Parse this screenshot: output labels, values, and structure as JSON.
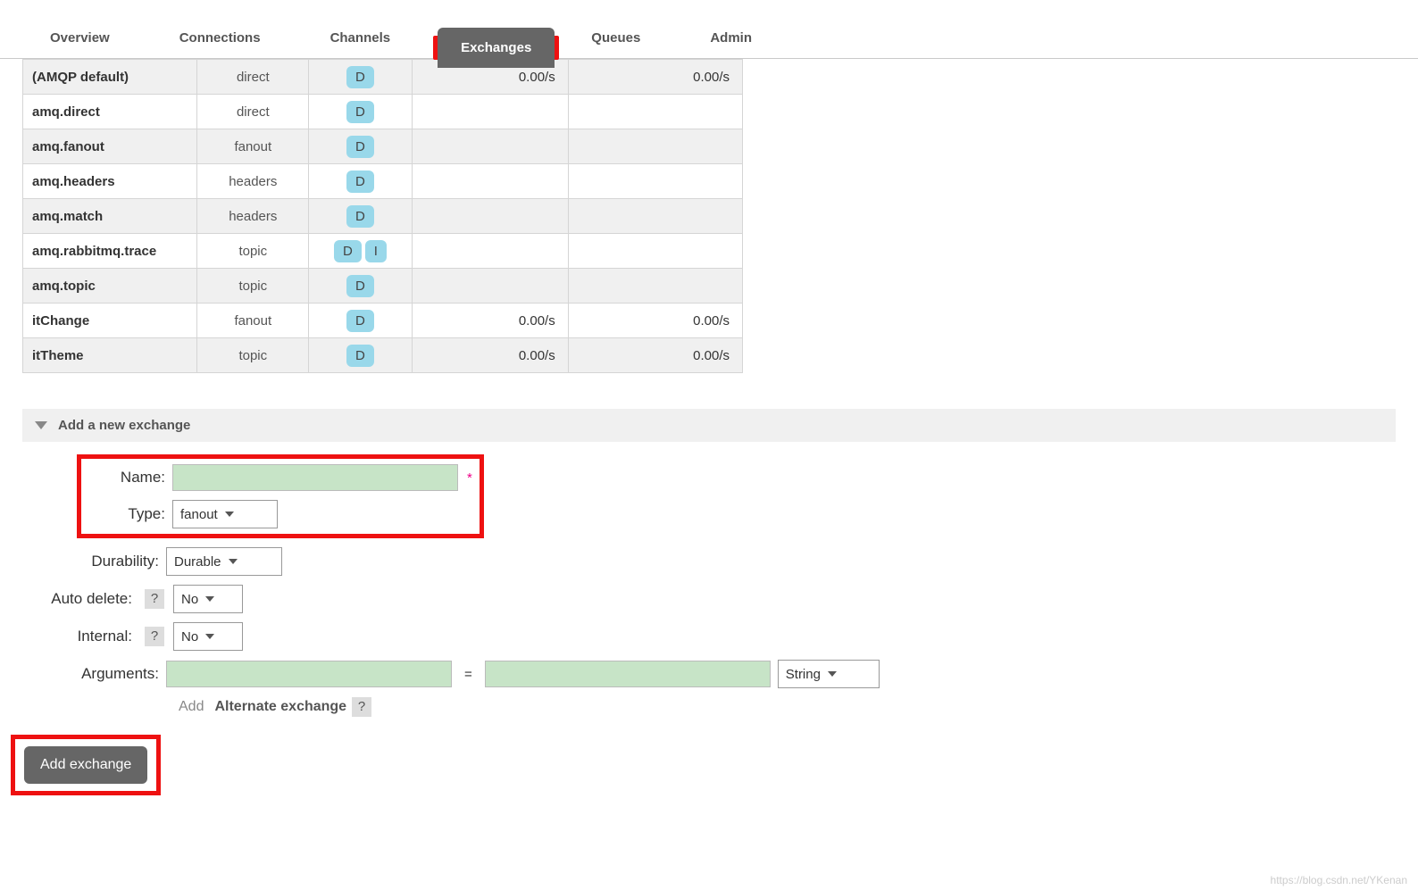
{
  "tabs": [
    "Overview",
    "Connections",
    "Channels",
    "Exchanges",
    "Queues",
    "Admin"
  ],
  "active_tab": "Exchanges",
  "exchanges": [
    {
      "name": "(AMQP default)",
      "type": "direct",
      "features": [
        "D"
      ],
      "rate_in": "0.00/s",
      "rate_out": "0.00/s"
    },
    {
      "name": "amq.direct",
      "type": "direct",
      "features": [
        "D"
      ],
      "rate_in": "",
      "rate_out": ""
    },
    {
      "name": "amq.fanout",
      "type": "fanout",
      "features": [
        "D"
      ],
      "rate_in": "",
      "rate_out": ""
    },
    {
      "name": "amq.headers",
      "type": "headers",
      "features": [
        "D"
      ],
      "rate_in": "",
      "rate_out": ""
    },
    {
      "name": "amq.match",
      "type": "headers",
      "features": [
        "D"
      ],
      "rate_in": "",
      "rate_out": ""
    },
    {
      "name": "amq.rabbitmq.trace",
      "type": "topic",
      "features": [
        "D",
        "I"
      ],
      "rate_in": "",
      "rate_out": ""
    },
    {
      "name": "amq.topic",
      "type": "topic",
      "features": [
        "D"
      ],
      "rate_in": "",
      "rate_out": ""
    },
    {
      "name": "itChange",
      "type": "fanout",
      "features": [
        "D"
      ],
      "rate_in": "0.00/s",
      "rate_out": "0.00/s"
    },
    {
      "name": "itTheme",
      "type": "topic",
      "features": [
        "D"
      ],
      "rate_in": "0.00/s",
      "rate_out": "0.00/s"
    }
  ],
  "add_section_title": "Add a new exchange",
  "form": {
    "name_label": "Name:",
    "name_value": "",
    "star": "*",
    "type_label": "Type:",
    "type_value": "fanout",
    "durability_label": "Durability:",
    "durability_value": "Durable",
    "autodelete_label": "Auto delete:",
    "autodelete_value": "No",
    "internal_label": "Internal:",
    "internal_value": "No",
    "arguments_label": "Arguments:",
    "arg_key": "",
    "arg_eq": "=",
    "arg_val": "",
    "arg_type": "String",
    "add_link": "Add",
    "alt_ex": "Alternate exchange",
    "help": "?",
    "submit": "Add exchange"
  },
  "watermark": "https://blog.csdn.net/YKenan"
}
